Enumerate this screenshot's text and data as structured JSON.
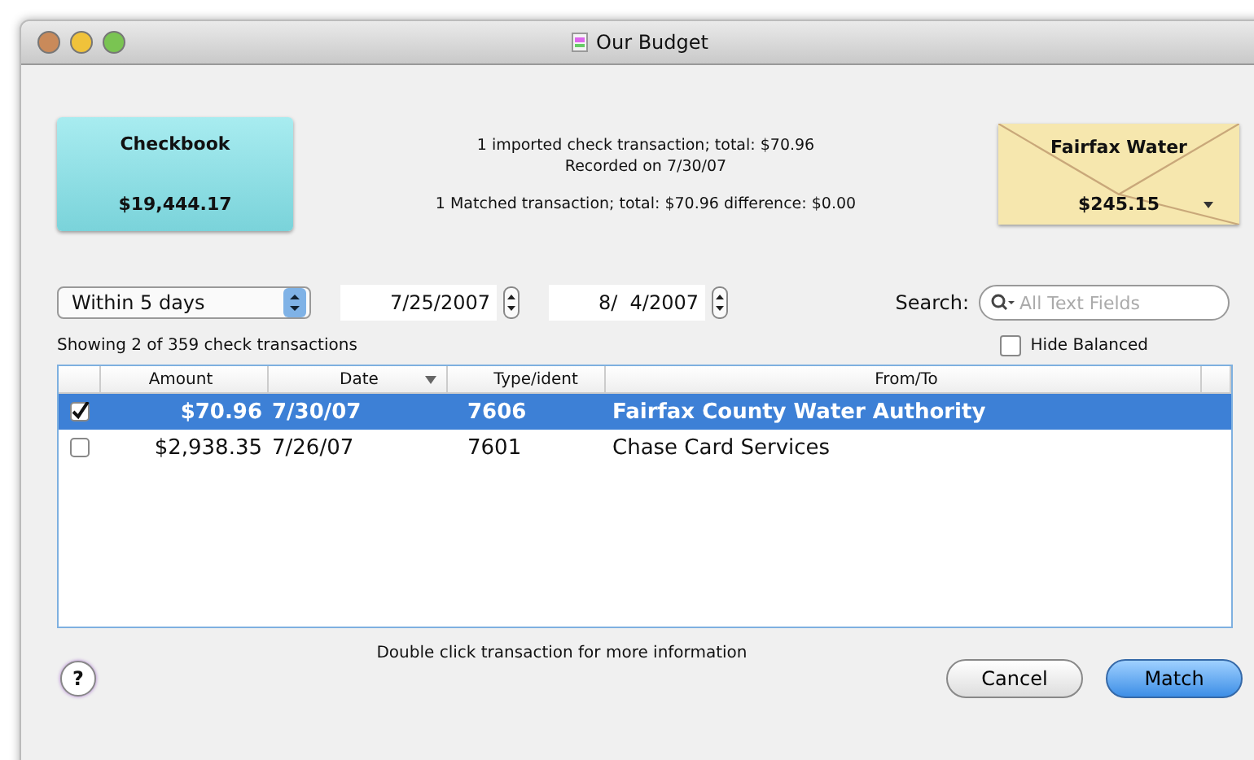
{
  "window": {
    "title": "Our Budget"
  },
  "account_card": {
    "name": "Checkbook",
    "balance": "$19,444.17"
  },
  "summary": {
    "imported": "1 imported check transaction; total: $70.96",
    "recorded": "Recorded on 7/30/07",
    "matched": "1 Matched transaction; total: $70.96  difference: $0.00"
  },
  "payee_card": {
    "name": "Fairfax Water",
    "amount": "$245.15"
  },
  "filter": {
    "range": "Within 5 days",
    "start_date": "7/25/2007",
    "end_date": "8/  4/2007"
  },
  "search": {
    "label": "Search:",
    "placeholder": "All Text Fields"
  },
  "hide_balanced": {
    "label": "Hide Balanced",
    "checked": false
  },
  "showing": "Showing 2 of 359 check transactions",
  "table": {
    "columns": [
      "Amount",
      "Date",
      "Type/ident",
      "From/To"
    ],
    "rows": [
      {
        "checked": true,
        "selected": true,
        "cells": [
          "$70.96",
          "7/30/07",
          "7606",
          "Fairfax County Water Authority"
        ]
      },
      {
        "checked": false,
        "selected": false,
        "cells": [
          "$2,938.35",
          "7/26/07",
          "7601",
          "Chase Card Services"
        ]
      }
    ]
  },
  "hint": "Double click transaction for more information",
  "help": "?",
  "buttons": [
    {
      "label": "Cancel",
      "kind": "normal"
    },
    {
      "label": "Match",
      "kind": "default"
    }
  ]
}
